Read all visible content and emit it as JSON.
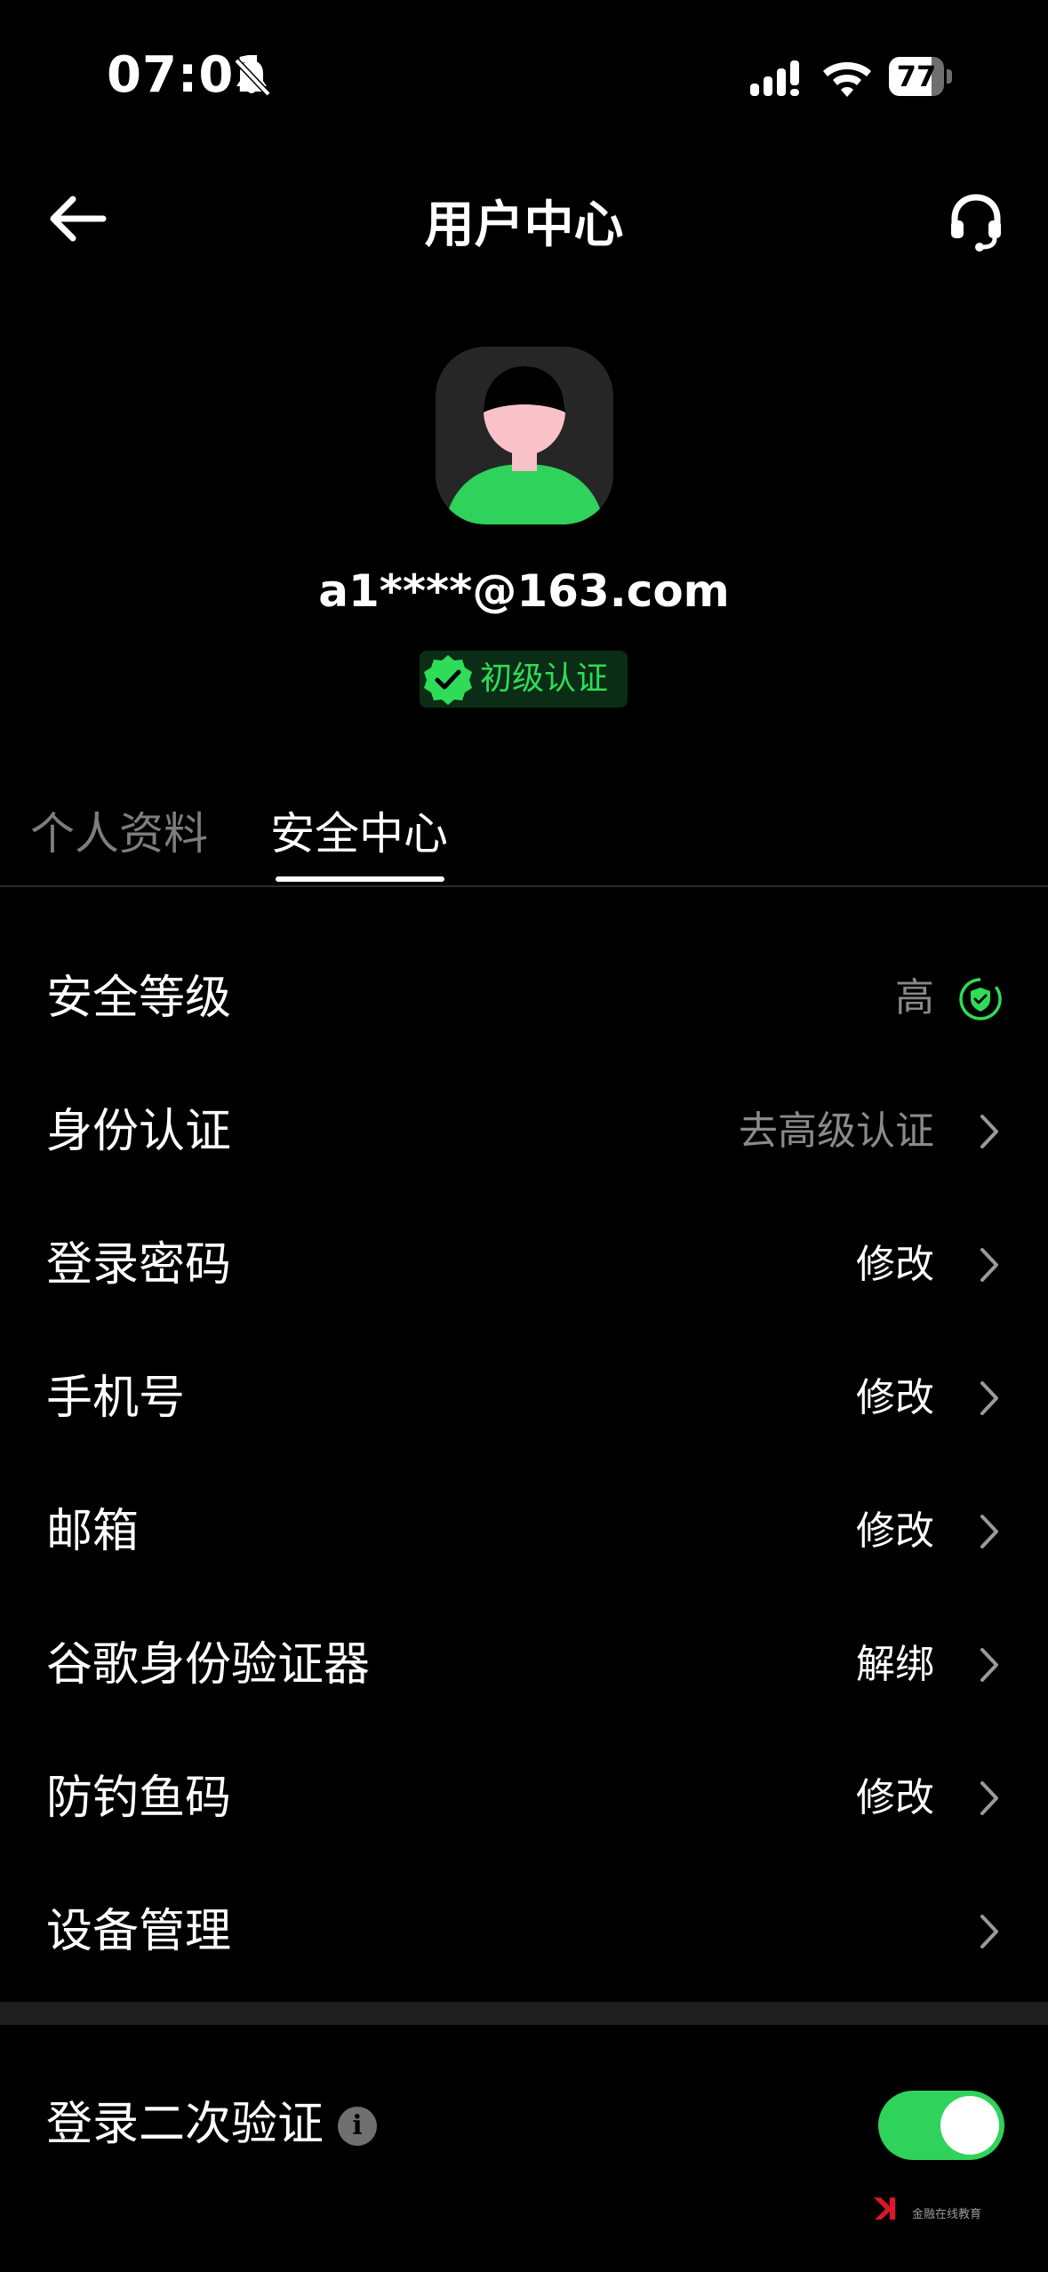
{
  "status_bar": {
    "time": "07:01",
    "battery": "77",
    "battery_level_percent": 77,
    "icons": [
      "bell-muted-icon",
      "signal-icon",
      "wifi-icon",
      "battery-icon"
    ]
  },
  "header": {
    "title": "用户中心",
    "icons": [
      "back-arrow-icon",
      "headset-support-icon"
    ]
  },
  "profile": {
    "email": "a1****@163.com",
    "verification_badge": "初级认证",
    "accent_color": "#2fdc57"
  },
  "tabs": [
    {
      "label": "个人资料",
      "active": false
    },
    {
      "label": "安全中心",
      "active": true
    }
  ],
  "security": {
    "level": {
      "label": "安全等级",
      "value": "高"
    },
    "rows": [
      {
        "label": "身份认证",
        "value": "去高级认证"
      },
      {
        "label": "登录密码",
        "value": "修改"
      },
      {
        "label": "手机号",
        "value": "修改"
      },
      {
        "label": "邮箱",
        "value": "修改"
      },
      {
        "label": "谷歌身份验证器",
        "value": "解绑"
      },
      {
        "label": "防钓鱼码",
        "value": "修改"
      },
      {
        "label": "设备管理",
        "value": ""
      }
    ],
    "two_factor": {
      "label": "登录二次验证",
      "enabled": true,
      "toggle_color": "#2fd25a"
    }
  },
  "watermark": {
    "text": "金融在线教育"
  }
}
